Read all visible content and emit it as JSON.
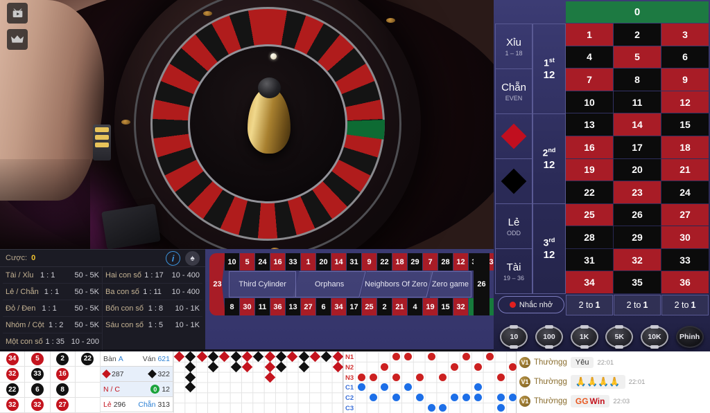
{
  "overlay_icons": [
    {
      "name": "video-icon",
      "glyph": "tv"
    },
    {
      "name": "crown-icon",
      "glyph": "crown"
    }
  ],
  "bet_info": {
    "stake_label": "Cược:",
    "stake_value": "0",
    "info_icon": "i",
    "spade_icon": "♠",
    "left_rows": [
      {
        "name": "Tài / Xỉu",
        "odds": "1 : 1",
        "limit": "50 - 5K"
      },
      {
        "name": "Lẻ / Chẵn",
        "odds": "1 : 1",
        "limit": "50 - 5K"
      },
      {
        "name": "Đỏ / Đen",
        "odds": "1 : 1",
        "limit": "50 - 5K"
      },
      {
        "name": "Nhóm / Cột",
        "odds": "1 : 2",
        "limit": "50 - 5K"
      },
      {
        "name": "Một con số",
        "odds": "1 : 35",
        "limit": "10 - 200"
      }
    ],
    "right_rows": [
      {
        "name": "Hai con số",
        "odds": "1 : 17",
        "limit": "10 - 400"
      },
      {
        "name": "Ba con số",
        "odds": "1 : 11",
        "limit": "10 - 400"
      },
      {
        "name": "Bốn con số",
        "odds": "1 : 8",
        "limit": "10 - 1K"
      },
      {
        "name": "Sáu con số",
        "odds": "1 : 5",
        "limit": "10 - 1K"
      }
    ]
  },
  "racetrack": {
    "left_number": {
      "n": "23",
      "color": "red"
    },
    "right_number": {
      "n": "26",
      "color": "black"
    },
    "top": [
      {
        "n": "10",
        "color": "black"
      },
      {
        "n": "5",
        "color": "red"
      },
      {
        "n": "24",
        "color": "black"
      },
      {
        "n": "16",
        "color": "red"
      },
      {
        "n": "33",
        "color": "black"
      },
      {
        "n": "1",
        "color": "red"
      },
      {
        "n": "20",
        "color": "black"
      },
      {
        "n": "14",
        "color": "red"
      },
      {
        "n": "31",
        "color": "black"
      },
      {
        "n": "9",
        "color": "red"
      },
      {
        "n": "22",
        "color": "black"
      },
      {
        "n": "18",
        "color": "red"
      },
      {
        "n": "29",
        "color": "black"
      },
      {
        "n": "7",
        "color": "red"
      },
      {
        "n": "28",
        "color": "black"
      },
      {
        "n": "12",
        "color": "red"
      },
      {
        "n": "35",
        "color": "black"
      },
      {
        "n": "3",
        "color": "red"
      }
    ],
    "bottom": [
      {
        "n": "8",
        "color": "black"
      },
      {
        "n": "30",
        "color": "red"
      },
      {
        "n": "11",
        "color": "black"
      },
      {
        "n": "36",
        "color": "red"
      },
      {
        "n": "13",
        "color": "black"
      },
      {
        "n": "27",
        "color": "red"
      },
      {
        "n": "6",
        "color": "black"
      },
      {
        "n": "34",
        "color": "red"
      },
      {
        "n": "17",
        "color": "black"
      },
      {
        "n": "25",
        "color": "red"
      },
      {
        "n": "2",
        "color": "black"
      },
      {
        "n": "21",
        "color": "red"
      },
      {
        "n": "4",
        "color": "black"
      },
      {
        "n": "19",
        "color": "red"
      },
      {
        "n": "15",
        "color": "black"
      },
      {
        "n": "32",
        "color": "red"
      },
      {
        "n": "0",
        "color": "green"
      }
    ],
    "segments": [
      "Third Cylinder",
      "Orphans",
      "Neighbors Of Zero",
      "Zero game"
    ]
  },
  "board": {
    "zero": "0",
    "outside": [
      {
        "type": "text",
        "main": "Xỉu",
        "sub": "1 – 18"
      },
      {
        "type": "text",
        "main": "Chẵn",
        "sub": "EVEN"
      },
      {
        "type": "diamond",
        "color": "red"
      },
      {
        "type": "diamond",
        "color": "black"
      },
      {
        "type": "text",
        "main": "Lẻ",
        "sub": "ODD"
      },
      {
        "type": "text",
        "main": "Tài",
        "sub": "19 – 36"
      }
    ],
    "dozens": [
      {
        "ord": "1",
        "sup": "st",
        "num": "12"
      },
      {
        "ord": "2",
        "sup": "nd",
        "num": "12"
      },
      {
        "ord": "3",
        "sup": "rd",
        "num": "12"
      }
    ],
    "numbers": [
      {
        "n": "1",
        "color": "red"
      },
      {
        "n": "2",
        "color": "black"
      },
      {
        "n": "3",
        "color": "red"
      },
      {
        "n": "4",
        "color": "black"
      },
      {
        "n": "5",
        "color": "red"
      },
      {
        "n": "6",
        "color": "black"
      },
      {
        "n": "7",
        "color": "red"
      },
      {
        "n": "8",
        "color": "black"
      },
      {
        "n": "9",
        "color": "red"
      },
      {
        "n": "10",
        "color": "black"
      },
      {
        "n": "11",
        "color": "black"
      },
      {
        "n": "12",
        "color": "red"
      },
      {
        "n": "13",
        "color": "black"
      },
      {
        "n": "14",
        "color": "red"
      },
      {
        "n": "15",
        "color": "black"
      },
      {
        "n": "16",
        "color": "red"
      },
      {
        "n": "17",
        "color": "black"
      },
      {
        "n": "18",
        "color": "red"
      },
      {
        "n": "19",
        "color": "red"
      },
      {
        "n": "20",
        "color": "black"
      },
      {
        "n": "21",
        "color": "red"
      },
      {
        "n": "22",
        "color": "black"
      },
      {
        "n": "23",
        "color": "red"
      },
      {
        "n": "24",
        "color": "black"
      },
      {
        "n": "25",
        "color": "red"
      },
      {
        "n": "26",
        "color": "black"
      },
      {
        "n": "27",
        "color": "red"
      },
      {
        "n": "28",
        "color": "black"
      },
      {
        "n": "29",
        "color": "black"
      },
      {
        "n": "30",
        "color": "red"
      },
      {
        "n": "31",
        "color": "black"
      },
      {
        "n": "32",
        "color": "red"
      },
      {
        "n": "33",
        "color": "black"
      },
      {
        "n": "34",
        "color": "red"
      },
      {
        "n": "35",
        "color": "black"
      },
      {
        "n": "36",
        "color": "red"
      }
    ],
    "columns_label": "2 to 1",
    "columns_count": 3,
    "remind_label": "Nhắc nhở"
  },
  "chips": [
    {
      "label": "10"
    },
    {
      "label": "100"
    },
    {
      "label": "1K"
    },
    {
      "label": "5K"
    },
    {
      "label": "10K"
    },
    {
      "label": "Phinh"
    }
  ],
  "history": [
    {
      "n": "34",
      "color": "red"
    },
    {
      "n": "5",
      "color": "red"
    },
    {
      "n": "2",
      "color": "black"
    },
    {
      "n": "22",
      "color": "black"
    },
    {
      "n": "32",
      "color": "red"
    },
    {
      "n": "33",
      "color": "black"
    },
    {
      "n": "16",
      "color": "red"
    },
    {
      "n": "",
      "color": "none"
    },
    {
      "n": "22",
      "color": "black"
    },
    {
      "n": "6",
      "color": "black"
    },
    {
      "n": "8",
      "color": "black"
    },
    {
      "n": "",
      "color": "none"
    },
    {
      "n": "32",
      "color": "red"
    },
    {
      "n": "32",
      "color": "red"
    },
    {
      "n": "27",
      "color": "red"
    },
    {
      "n": "",
      "color": "none"
    }
  ],
  "stats": {
    "table_label": "Bàn",
    "table_value": "A",
    "round_label": "Ván",
    "round_value": "621",
    "red_count": "287",
    "black_count": "322",
    "nc_label": "N / C",
    "zero_label": "0",
    "zero_count": "12",
    "odd_label": "Lẻ",
    "odd_count": "296",
    "even_label": "Chẵn",
    "even_count": "313"
  },
  "roadmap": {
    "columns": [
      [
        "red"
      ],
      [
        "black",
        "black",
        "black",
        "black"
      ],
      [
        "red"
      ],
      [
        "black",
        "black"
      ],
      [
        "red"
      ],
      [
        "black",
        "black"
      ],
      [
        "red",
        "red"
      ],
      [
        "black"
      ],
      [
        "red",
        "red",
        "red"
      ],
      [
        "black",
        "black"
      ],
      [
        "red"
      ],
      [
        "black",
        "black"
      ],
      [
        "red"
      ],
      [
        "black"
      ],
      [
        "red",
        "red"
      ],
      [
        "black"
      ]
    ]
  },
  "nc_chart": {
    "row_labels": [
      "N1",
      "N2",
      "N3",
      "C1",
      "C2",
      "C3"
    ],
    "rows": [
      {
        "label": "N1",
        "type": "n",
        "cols": [
          4,
          5,
          7,
          10,
          12
        ]
      },
      {
        "label": "N2",
        "type": "n",
        "cols": [
          3,
          9,
          11,
          14,
          15
        ]
      },
      {
        "label": "N3",
        "type": "n",
        "cols": [
          1,
          2,
          4,
          6,
          8,
          13
        ]
      },
      {
        "label": "C1",
        "type": "c",
        "cols": [
          1,
          3,
          5,
          11,
          15
        ]
      },
      {
        "label": "C2",
        "type": "c",
        "cols": [
          2,
          4,
          6,
          9,
          10,
          11,
          13,
          14
        ]
      },
      {
        "label": "C3",
        "type": "c",
        "cols": [
          7,
          8,
          13
        ]
      }
    ]
  },
  "chat": {
    "messages": [
      {
        "badge": "V1",
        "user": "Thườngg",
        "text": "Yêu",
        "kind": "text",
        "time": "22:01"
      },
      {
        "badge": "V1",
        "user": "Thườngg",
        "text": "🙏🙏🙏🙏",
        "kind": "emoji",
        "time": "22:01"
      },
      {
        "badge": "V1",
        "user": "Thườngg",
        "text": "GG Win",
        "kind": "gg",
        "time": "22:03"
      }
    ]
  },
  "wheel": {
    "sequence": [
      "0",
      "32",
      "15",
      "19",
      "4",
      "21",
      "2",
      "25",
      "17",
      "34",
      "6",
      "27",
      "13",
      "36",
      "11",
      "30",
      "8",
      "23",
      "10",
      "5",
      "24",
      "16",
      "33",
      "1",
      "20",
      "14",
      "31",
      "9",
      "22",
      "18",
      "29",
      "7",
      "28",
      "12",
      "35",
      "3",
      "26"
    ]
  },
  "colors": {
    "red": "#a81c26",
    "black": "#0b0b0b",
    "green": "#1d7a42",
    "board_bg": "#2b2b58",
    "accent_yellow": "#f2c430"
  }
}
